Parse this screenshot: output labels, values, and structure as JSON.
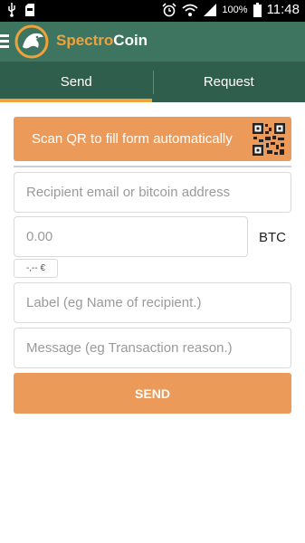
{
  "status_bar": {
    "battery_percent": "100%",
    "time": "11:48",
    "icons": [
      "usb-icon",
      "sd-card-icon",
      "alarm-icon",
      "wifi-icon",
      "signal-icon",
      "battery-icon"
    ]
  },
  "appbar": {
    "brand_part1": "Spectro",
    "brand_part2": "Coin",
    "colors": {
      "bar": "#3d7561",
      "accent": "#f0a23a"
    }
  },
  "tabs": [
    {
      "label": "Send",
      "active": true
    },
    {
      "label": "Request",
      "active": false
    }
  ],
  "form": {
    "scan_label": "Scan QR to fill form automatically",
    "recipient_placeholder": "Recipient email or bitcoin address",
    "amount_placeholder": "0.00",
    "amount_unit": "BTC",
    "fiat_value": "-,-- €",
    "label_placeholder": "Label (eg Name of recipient.)",
    "message_placeholder": "Message (eg Transaction reason.)",
    "send_label": "SEND",
    "button_color": "#ec9a59"
  }
}
